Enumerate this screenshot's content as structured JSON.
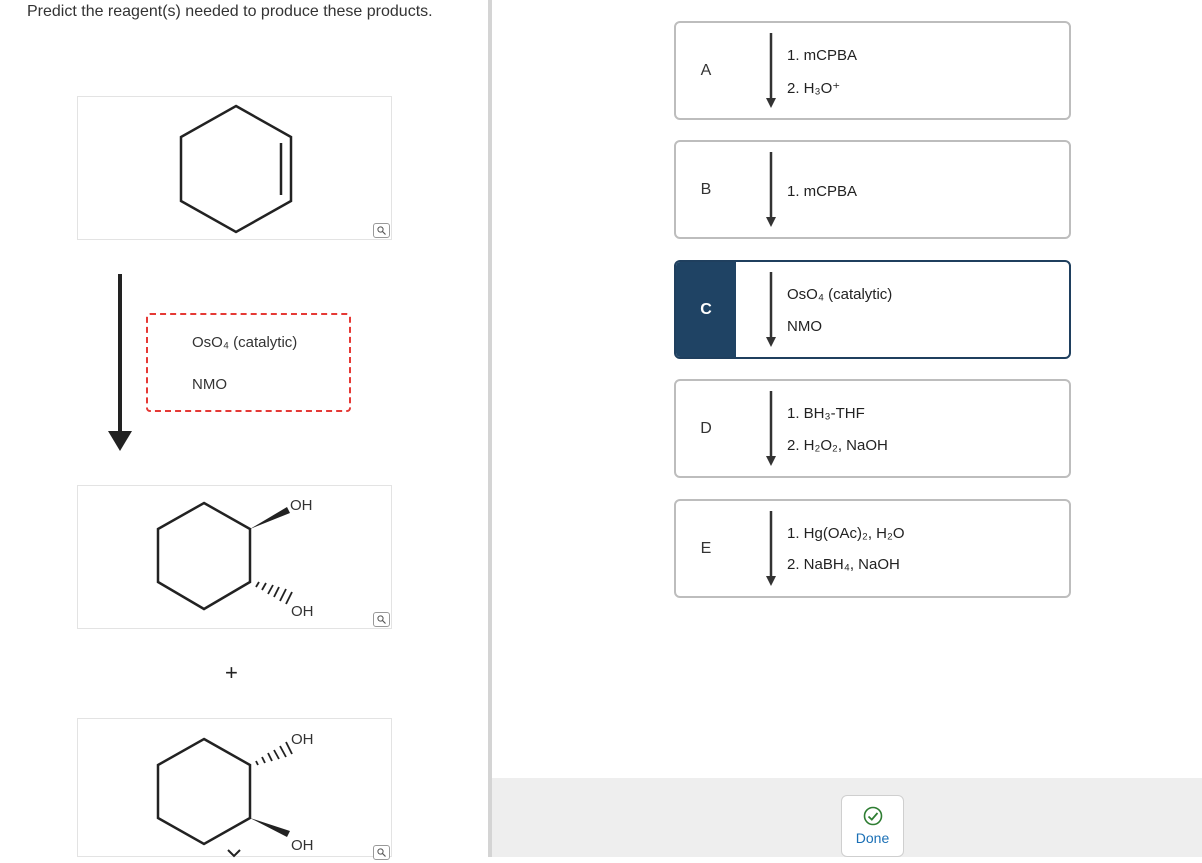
{
  "question": {
    "text": "Predict the reagent(s) needed to produce these products."
  },
  "left": {
    "reagents": [
      "OsO₄ (catalytic)",
      "NMO"
    ],
    "plus": "+",
    "product1": {
      "label_top": "OH",
      "label_bottom": "OH"
    },
    "product2": {
      "label_top": "OH",
      "label_bottom": "OH"
    }
  },
  "options": [
    {
      "letter": "A",
      "lines": [
        "1. mCPBA",
        "2. H₃O⁺"
      ],
      "selected": false
    },
    {
      "letter": "B",
      "lines": [
        "1. mCPBA"
      ],
      "selected": false
    },
    {
      "letter": "C",
      "lines": [
        "OsO₄ (catalytic)",
        "NMO"
      ],
      "selected": true
    },
    {
      "letter": "D",
      "lines": [
        "1. BH₃-THF",
        "2. H₂O₂, NaOH"
      ],
      "selected": false
    },
    {
      "letter": "E",
      "lines": [
        "1. Hg(OAc)₂, H₂O",
        "2. NaBH₄, NaOH"
      ],
      "selected": false
    }
  ],
  "done_button": {
    "label": "Done"
  },
  "colors": {
    "selected": "#1f4364",
    "dashed_border": "#e53935",
    "done_text": "#1a6fb5"
  }
}
